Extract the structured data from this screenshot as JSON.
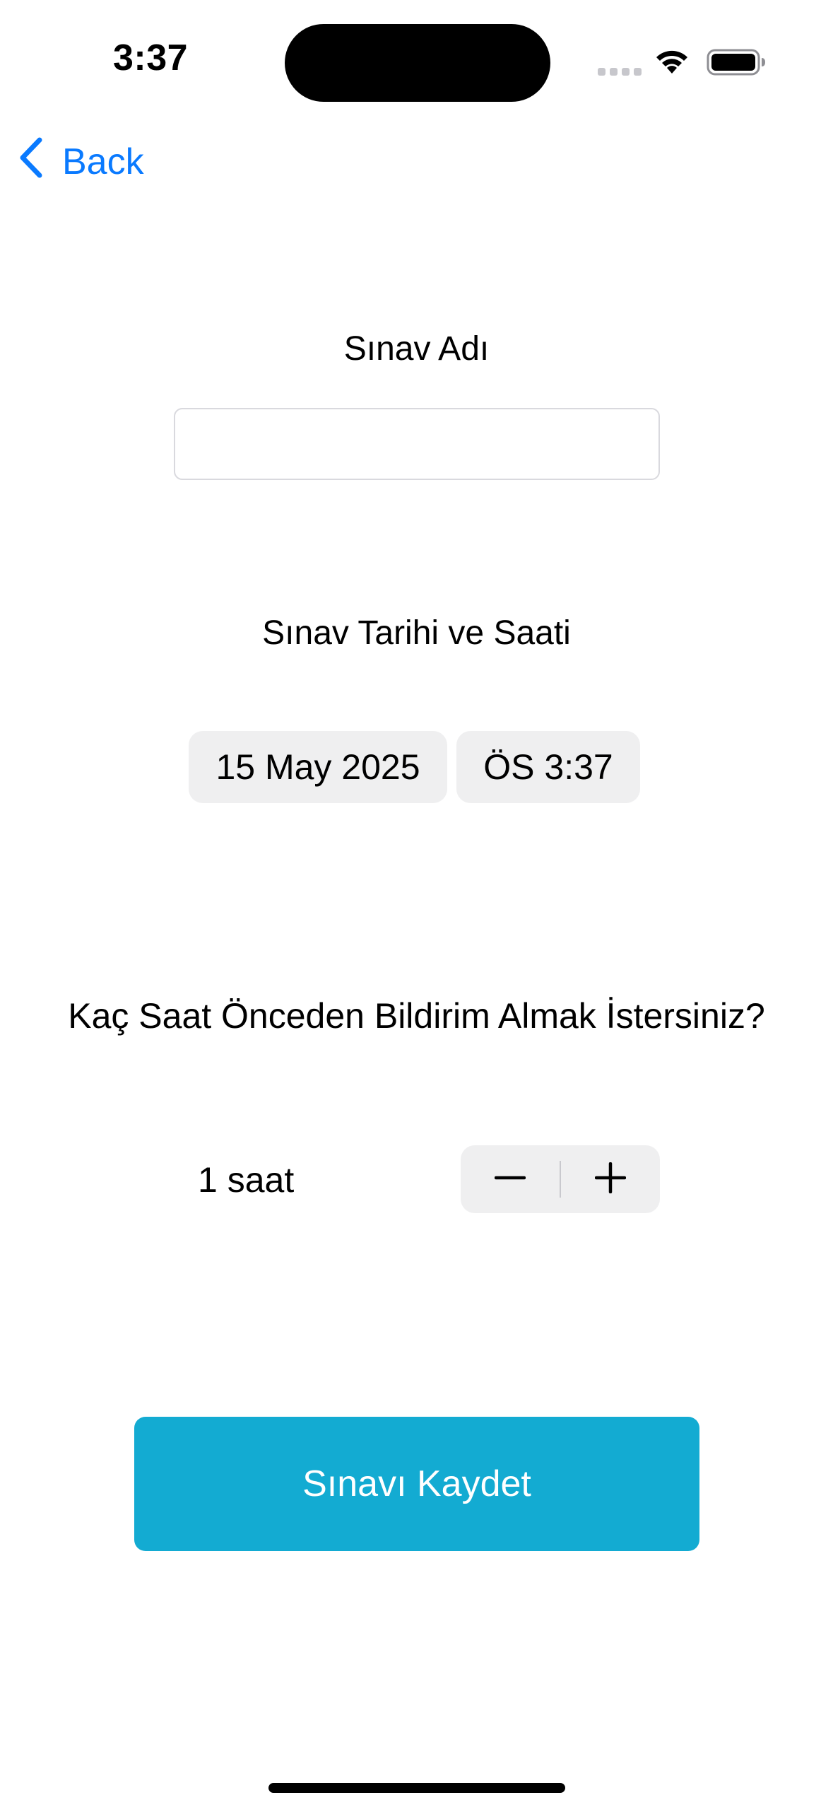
{
  "status_bar": {
    "time": "3:37"
  },
  "nav": {
    "back_label": "Back"
  },
  "form": {
    "name_label": "Sınav Adı",
    "name_value": "",
    "date_label": "Sınav Tarihi ve Saati",
    "date_value": "15 May 2025",
    "time_value": "ÖS 3:37",
    "notify_label": "Kaç Saat Önceden Bildirim Almak İstersiniz?",
    "hours_value": "1 saat",
    "save_label": "Sınavı Kaydet"
  },
  "colors": {
    "accent_link": "#0a7aff",
    "button_bg": "#13abd2",
    "pill_bg": "#efeff0"
  },
  "icons": {
    "back": "chevron-left-icon",
    "decrement": "minus-icon",
    "increment": "plus-icon",
    "wifi": "wifi-icon",
    "battery": "battery-icon",
    "signal": "cellular-signal-icon"
  }
}
